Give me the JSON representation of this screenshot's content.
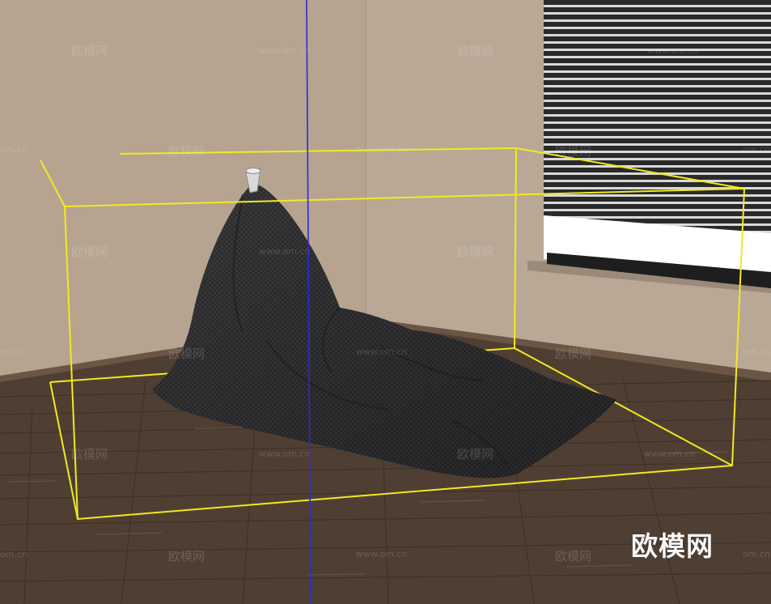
{
  "watermark": {
    "logo_text": "欧模网",
    "site_url": "www.om.cn",
    "url_short": "om.cn"
  },
  "colors": {
    "wall_left": "#b6a491",
    "wall_right": "#b9a896",
    "floor": "#4f3f33",
    "beanbag": "#2f2f31",
    "bounding_box": "#f2ea1e",
    "axis_line": "#2b2bd6",
    "window_light": "#ffffff",
    "blinds": "#2d2d2d"
  },
  "icons": [
    "cup-tag-icon"
  ]
}
